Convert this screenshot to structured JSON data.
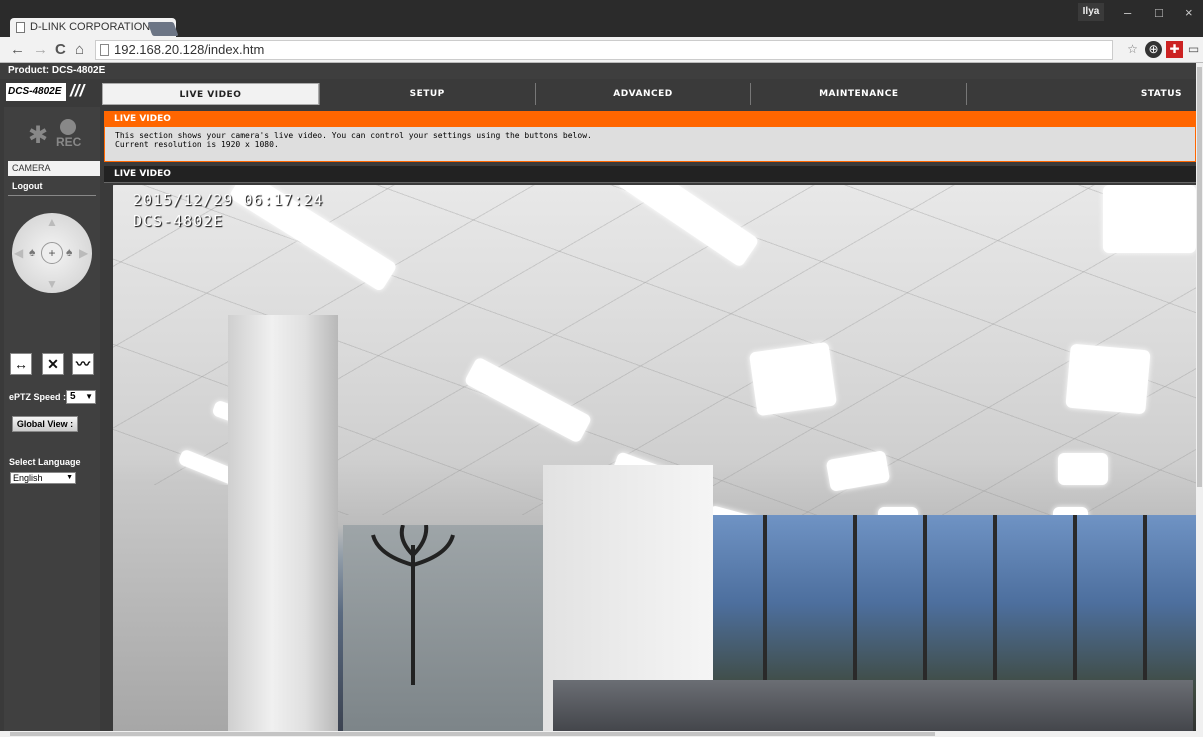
{
  "browser": {
    "tab_title": "D-LINK CORPORATION| IN",
    "tab_close": "×",
    "user": "Ilya",
    "url": "192.168.20.128/index.htm",
    "win_minimize": "–",
    "win_maximize": "□",
    "win_close": "×"
  },
  "page": {
    "product": "Product: DCS-4802E",
    "model": "DCS-4802E",
    "slashes": "///"
  },
  "topnav": [
    "LIVE VIDEO",
    "SETUP",
    "ADVANCED",
    "MAINTENANCE",
    "STATUS"
  ],
  "sidebar": {
    "rec_label": "REC",
    "camera": "CAMERA",
    "logout": "Logout",
    "eptz_label": "ePTZ Speed :",
    "eptz_value": "5",
    "global_view": "Global View :",
    "lang_label": "Select Language",
    "lang_value": "English"
  },
  "main": {
    "header": "LIVE VIDEO",
    "info_line1": "This section shows your camera's live video. You can control your settings using the buttons below.",
    "info_line2": "Current resolution is 1920 x 1080.",
    "live_header": "LIVE VIDEO",
    "osd_time": "2015/12/29 06:17:24",
    "osd_name": "DCS-4802E"
  },
  "colors": {
    "accent": "#ff6600",
    "nav_bg": "#3a3a3a"
  }
}
